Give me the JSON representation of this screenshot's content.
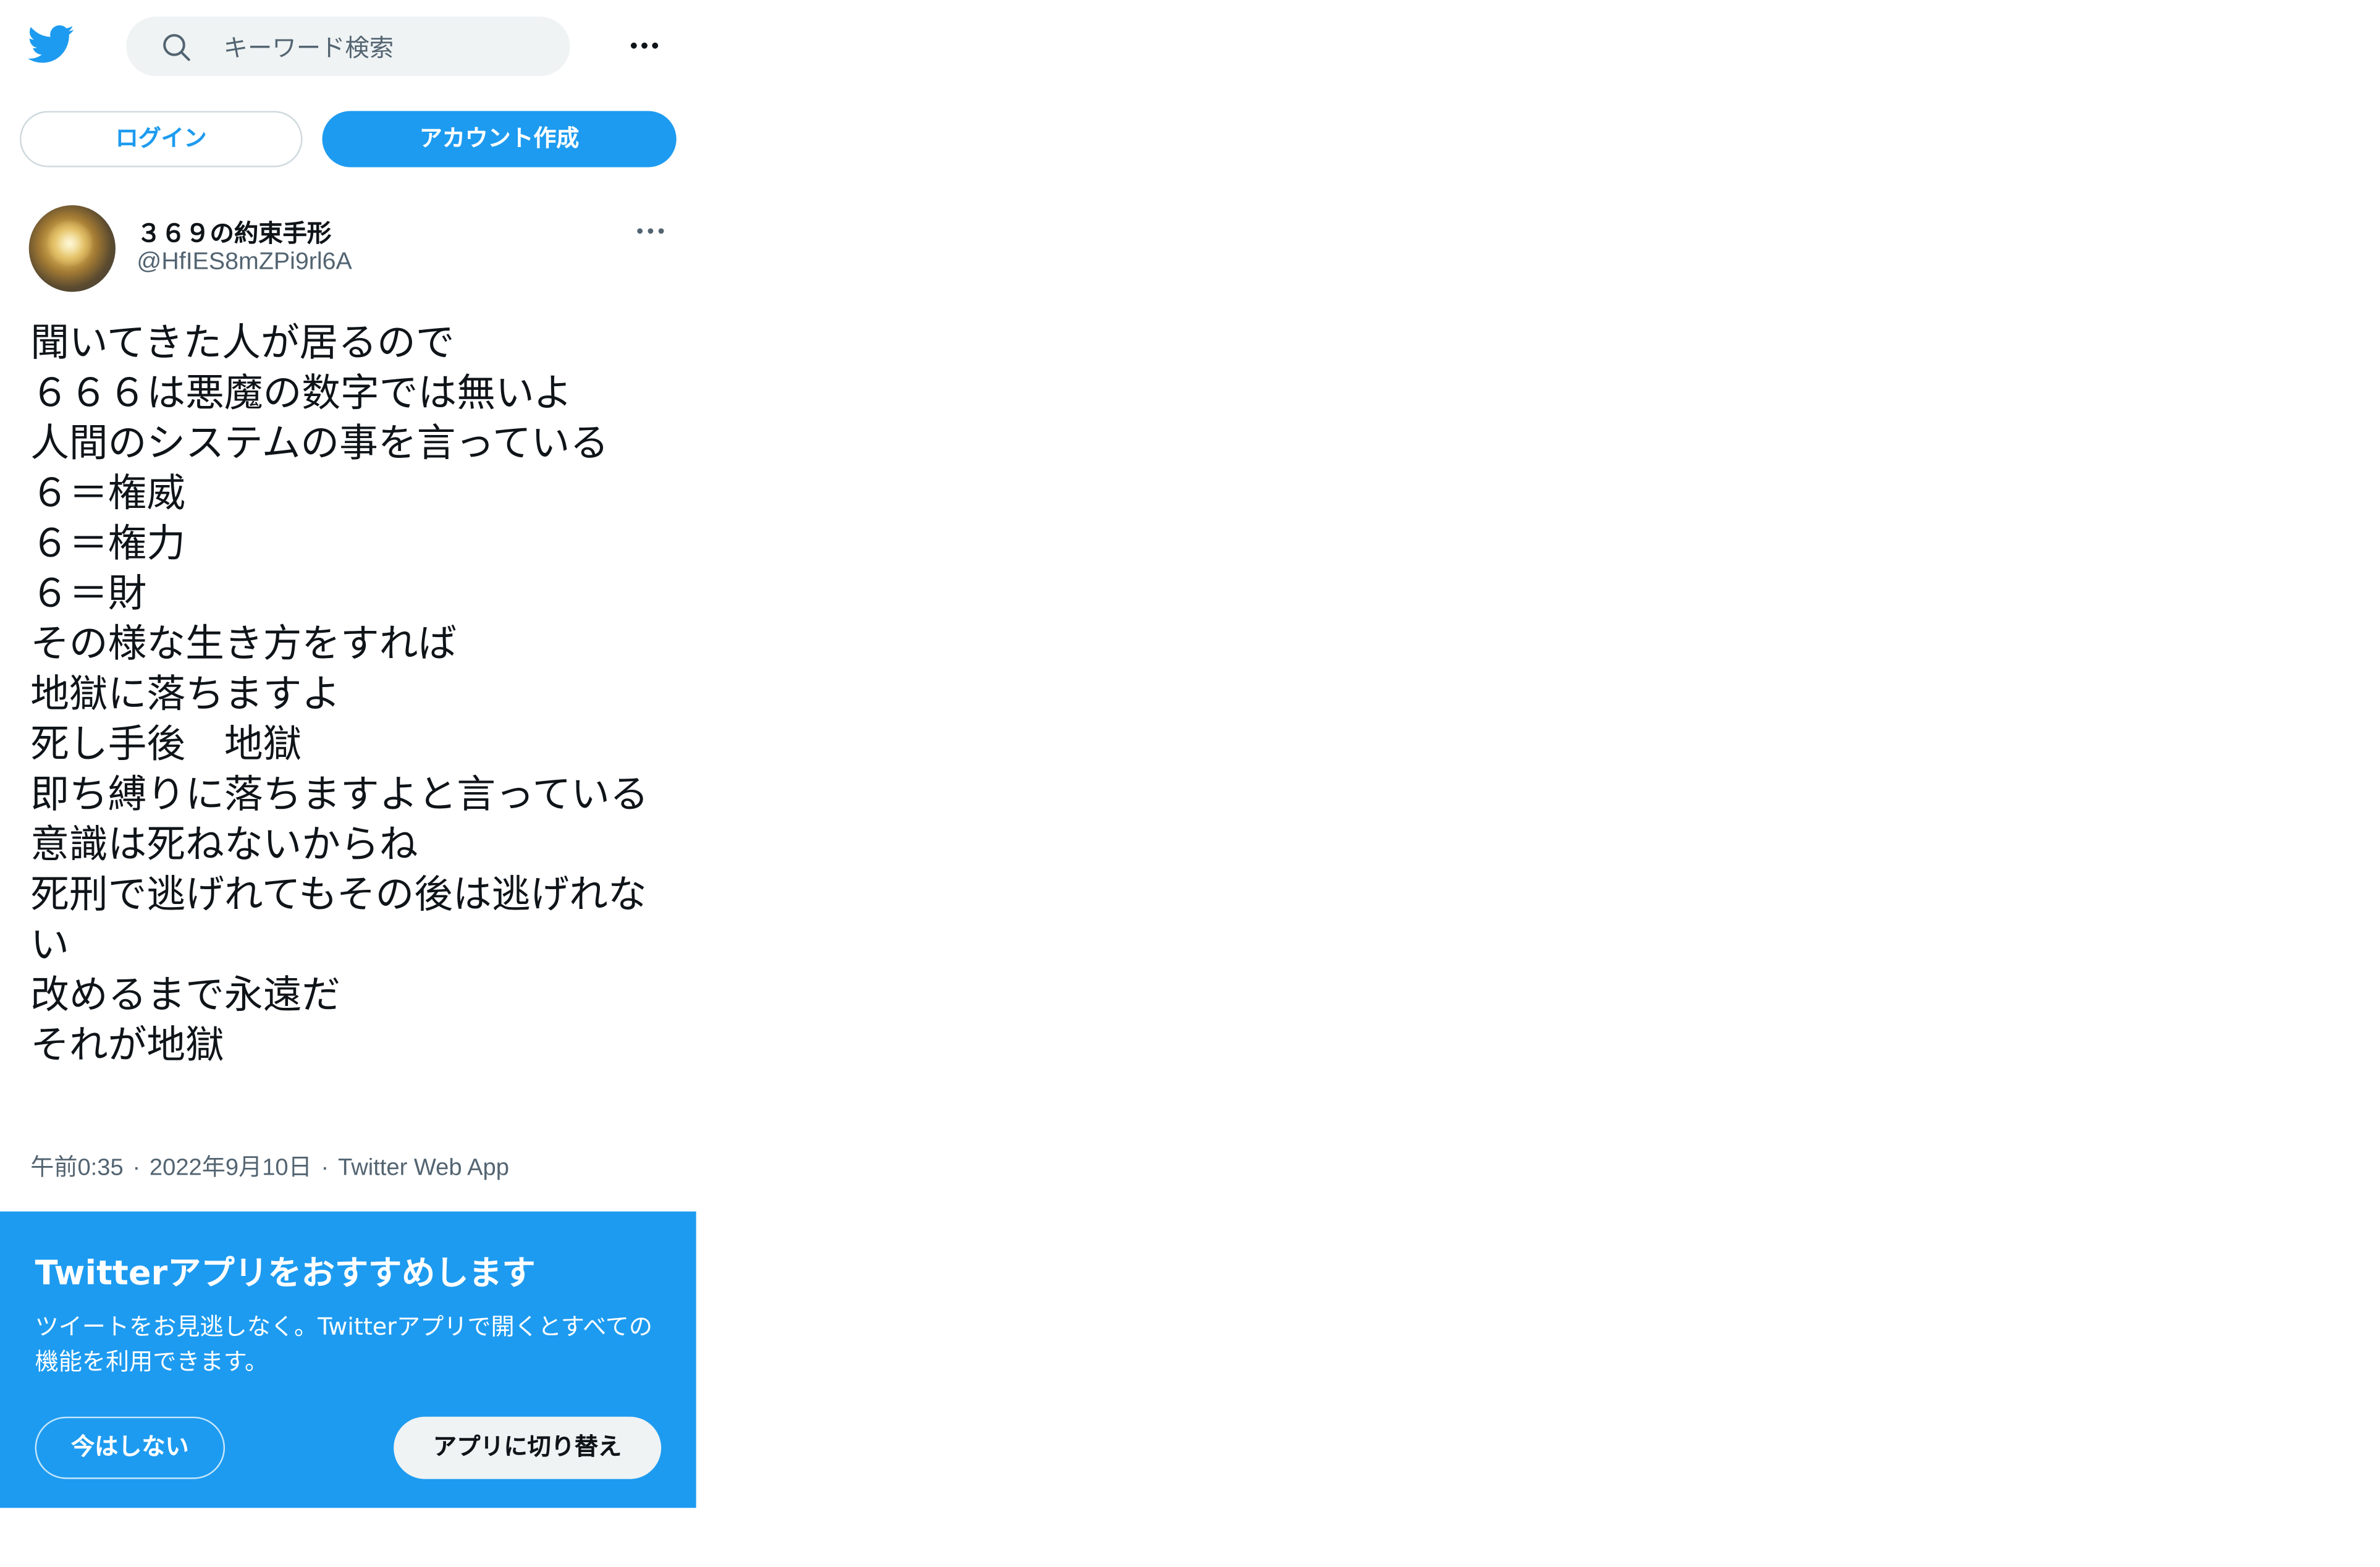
{
  "header": {
    "logo_icon": "twitter-bird-icon",
    "search_placeholder": "キーワード検索",
    "search_value": "",
    "more_icon": "more-horizontal-icon"
  },
  "auth": {
    "login_label": "ログイン",
    "signup_label": "アカウント作成"
  },
  "tweet": {
    "author_name": "３６９の約束手形",
    "author_handle": "@HfIES8mZPi9rl6A",
    "body": "聞いてきた人が居るので\n６６６は悪魔の数字では無いよ\n人間のシステムの事を言っている\n６＝権威\n６＝権力\n６＝財\nその様な生き方をすれば\n地獄に落ちますよ\n死し手後　地獄\n即ち縛りに落ちますよと言っている\n意識は死ねないからね\n死刑で逃げれてもその後は逃げれない\n改めるまで永遠だ\nそれが地獄",
    "time": "午前0:35",
    "date": "2022年9月10日",
    "source": "Twitter Web App",
    "separator": "·"
  },
  "promo": {
    "title": "Twitterアプリをおすすめします",
    "description": "ツイートをお見逃しなく。Twitterアプリで開くとすべての機能を利用できます。",
    "not_now_label": "今はしない",
    "switch_label": "アプリに切り替え"
  },
  "colors": {
    "brand_blue": "#1d9bf0",
    "text_primary": "#0f1419",
    "text_secondary": "#536471",
    "search_bg": "#eff3f4"
  }
}
